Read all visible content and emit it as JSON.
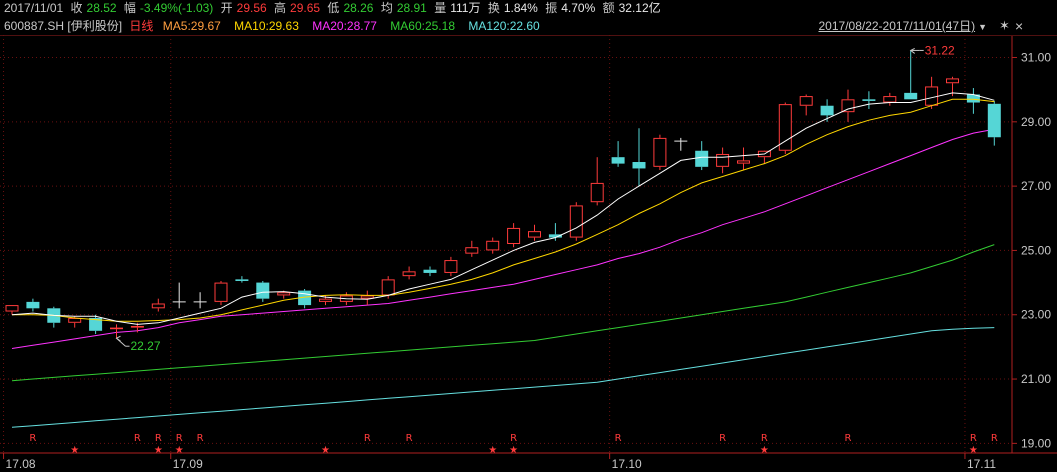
{
  "header": {
    "date": "2017/11/01",
    "close_label": "收",
    "close_value": "28.52",
    "change_label": "幅",
    "change_value": "-3.49%(-1.03)",
    "open_label": "开",
    "open_value": "29.56",
    "high_label": "高",
    "high_value": "29.65",
    "low_label": "低",
    "low_value": "28.26",
    "avg_label": "均",
    "avg_value": "28.91",
    "volume_label": "量",
    "volume_value": "111万",
    "turnover_label": "换",
    "turnover_value": "1.84%",
    "amplitude_label": "振",
    "amplitude_value": "4.70%",
    "amount_label": "额",
    "amount_value": "32.12亿"
  },
  "indicator_bar": {
    "stock": "600887.SH [伊利股份]",
    "period": "日线",
    "ma5": "MA5:29.67",
    "ma10": "MA10:29.63",
    "ma20": "MA20:28.77",
    "ma60": "MA60:25.18",
    "ma120": "MA120:22.60",
    "range": "2017/08/22-2017/11/01(47日)",
    "range_arrow": "▼"
  },
  "icons": {
    "settings": "✶",
    "close": "×"
  },
  "colors": {
    "up": "#ff3b3b",
    "down": "#55d6d6",
    "ma5": "#ffffff",
    "ma10": "#ffd700",
    "ma20": "#ff33ff",
    "ma60": "#33cc33",
    "ma120": "#66e0e0"
  },
  "chart_data": {
    "type": "candlestick",
    "ylim": [
      18.7,
      31.7
    ],
    "y_ticks": [
      "31.00",
      "29.00",
      "27.00",
      "25.00",
      "23.00",
      "21.00",
      "19.00"
    ],
    "y_tick_values": [
      31,
      29,
      27,
      25,
      23,
      21,
      19
    ],
    "x_labels": [
      {
        "label": "17.08",
        "index": 0
      },
      {
        "label": "17.09",
        "index": 8
      },
      {
        "label": "17.10",
        "index": 29
      },
      {
        "label": "17.11",
        "index": 46
      }
    ],
    "candles": [
      {
        "o": 23.1,
        "h": 23.3,
        "l": 23.0,
        "c": 23.3
      },
      {
        "o": 23.4,
        "h": 23.5,
        "l": 23.1,
        "c": 23.2
      },
      {
        "o": 23.2,
        "h": 23.25,
        "l": 22.6,
        "c": 22.75
      },
      {
        "o": 22.75,
        "h": 22.95,
        "l": 22.6,
        "c": 22.9
      },
      {
        "o": 22.9,
        "h": 23.0,
        "l": 22.4,
        "c": 22.5
      },
      {
        "o": 22.55,
        "h": 22.7,
        "l": 22.27,
        "c": 22.6
      },
      {
        "o": 22.6,
        "h": 22.75,
        "l": 22.45,
        "c": 22.65
      },
      {
        "o": 23.2,
        "h": 23.5,
        "l": 23.1,
        "c": 23.35
      },
      {
        "o": 23.4,
        "h": 24.0,
        "l": 23.2,
        "c": 23.4
      },
      {
        "o": 23.4,
        "h": 23.7,
        "l": 23.2,
        "c": 23.4
      },
      {
        "o": 23.4,
        "h": 24.05,
        "l": 23.3,
        "c": 24.0
      },
      {
        "o": 24.1,
        "h": 24.2,
        "l": 24.0,
        "c": 24.05
      },
      {
        "o": 24.0,
        "h": 24.05,
        "l": 23.4,
        "c": 23.5
      },
      {
        "o": 23.6,
        "h": 23.75,
        "l": 23.5,
        "c": 23.7
      },
      {
        "o": 23.75,
        "h": 23.8,
        "l": 23.2,
        "c": 23.3
      },
      {
        "o": 23.4,
        "h": 23.6,
        "l": 23.3,
        "c": 23.5
      },
      {
        "o": 23.4,
        "h": 23.7,
        "l": 23.3,
        "c": 23.6
      },
      {
        "o": 23.5,
        "h": 23.75,
        "l": 23.3,
        "c": 23.6
      },
      {
        "o": 23.6,
        "h": 24.2,
        "l": 23.5,
        "c": 24.1
      },
      {
        "o": 24.2,
        "h": 24.5,
        "l": 24.1,
        "c": 24.35
      },
      {
        "o": 24.4,
        "h": 24.5,
        "l": 24.2,
        "c": 24.3
      },
      {
        "o": 24.3,
        "h": 24.8,
        "l": 24.2,
        "c": 24.7
      },
      {
        "o": 24.9,
        "h": 25.3,
        "l": 24.8,
        "c": 25.1
      },
      {
        "o": 25.0,
        "h": 25.4,
        "l": 24.9,
        "c": 25.3
      },
      {
        "o": 25.2,
        "h": 25.85,
        "l": 25.1,
        "c": 25.7
      },
      {
        "o": 25.4,
        "h": 25.8,
        "l": 25.3,
        "c": 25.6
      },
      {
        "o": 25.5,
        "h": 25.85,
        "l": 25.3,
        "c": 25.4
      },
      {
        "o": 25.4,
        "h": 26.5,
        "l": 25.3,
        "c": 26.4
      },
      {
        "o": 26.5,
        "h": 27.9,
        "l": 26.4,
        "c": 27.1
      },
      {
        "o": 27.9,
        "h": 28.4,
        "l": 27.6,
        "c": 27.7
      },
      {
        "o": 27.75,
        "h": 28.8,
        "l": 27.0,
        "c": 27.55
      },
      {
        "o": 27.6,
        "h": 28.6,
        "l": 27.5,
        "c": 28.5
      },
      {
        "o": 28.4,
        "h": 28.5,
        "l": 28.1,
        "c": 28.4
      },
      {
        "o": 28.1,
        "h": 28.4,
        "l": 27.5,
        "c": 27.6
      },
      {
        "o": 27.6,
        "h": 28.2,
        "l": 27.4,
        "c": 28.0
      },
      {
        "o": 27.7,
        "h": 28.2,
        "l": 27.5,
        "c": 27.8
      },
      {
        "o": 27.9,
        "h": 28.0,
        "l": 27.7,
        "c": 28.1
      },
      {
        "o": 28.1,
        "h": 29.6,
        "l": 28.0,
        "c": 29.55
      },
      {
        "o": 29.5,
        "h": 29.85,
        "l": 29.2,
        "c": 29.8
      },
      {
        "o": 29.5,
        "h": 29.7,
        "l": 29.0,
        "c": 29.2
      },
      {
        "o": 29.3,
        "h": 30.0,
        "l": 29.0,
        "c": 29.7
      },
      {
        "o": 29.7,
        "h": 29.95,
        "l": 29.4,
        "c": 29.65
      },
      {
        "o": 29.6,
        "h": 29.9,
        "l": 29.5,
        "c": 29.8
      },
      {
        "o": 29.9,
        "h": 31.22,
        "l": 29.7,
        "c": 29.7
      },
      {
        "o": 29.5,
        "h": 30.4,
        "l": 29.4,
        "c": 30.1
      },
      {
        "o": 30.2,
        "h": 30.4,
        "l": 29.8,
        "c": 30.35
      },
      {
        "o": 29.85,
        "h": 30.05,
        "l": 29.25,
        "c": 29.6
      },
      {
        "o": 29.56,
        "h": 29.65,
        "l": 28.26,
        "c": 28.52
      }
    ],
    "ma5": [
      23.0,
      23.05,
      22.98,
      22.95,
      22.95,
      22.8,
      22.7,
      22.75,
      22.9,
      23.05,
      23.2,
      23.55,
      23.7,
      23.72,
      23.65,
      23.55,
      23.5,
      23.48,
      23.6,
      23.8,
      23.95,
      24.1,
      24.4,
      24.7,
      25.0,
      25.25,
      25.4,
      25.7,
      26.1,
      26.6,
      27.0,
      27.4,
      27.8,
      27.9,
      27.9,
      27.95,
      28.0,
      28.4,
      28.8,
      29.1,
      29.4,
      29.55,
      29.6,
      29.6,
      29.75,
      29.9,
      29.85,
      29.67
    ],
    "ma10": [
      23.0,
      23.0,
      22.98,
      22.9,
      22.85,
      22.8,
      22.8,
      22.82,
      22.85,
      22.9,
      23.0,
      23.15,
      23.3,
      23.45,
      23.55,
      23.6,
      23.62,
      23.6,
      23.6,
      23.7,
      23.82,
      23.95,
      24.1,
      24.3,
      24.55,
      24.75,
      24.95,
      25.2,
      25.5,
      25.8,
      26.15,
      26.45,
      26.8,
      27.1,
      27.3,
      27.5,
      27.7,
      27.95,
      28.3,
      28.6,
      28.85,
      29.05,
      29.2,
      29.3,
      29.5,
      29.7,
      29.7,
      29.63
    ],
    "ma20": [
      21.95,
      22.05,
      22.15,
      22.25,
      22.35,
      22.45,
      22.5,
      22.6,
      22.75,
      22.85,
      22.95,
      23.0,
      23.05,
      23.1,
      23.15,
      23.2,
      23.25,
      23.3,
      23.35,
      23.45,
      23.55,
      23.65,
      23.75,
      23.85,
      23.95,
      24.1,
      24.25,
      24.4,
      24.55,
      24.75,
      24.9,
      25.1,
      25.35,
      25.55,
      25.8,
      26.0,
      26.2,
      26.45,
      26.7,
      26.95,
      27.2,
      27.45,
      27.7,
      27.95,
      28.2,
      28.45,
      28.65,
      28.77
    ],
    "ma60": [
      20.95,
      21.0,
      21.05,
      21.1,
      21.15,
      21.2,
      21.25,
      21.3,
      21.35,
      21.4,
      21.45,
      21.5,
      21.55,
      21.6,
      21.65,
      21.7,
      21.75,
      21.8,
      21.85,
      21.9,
      21.95,
      22.0,
      22.05,
      22.1,
      22.15,
      22.2,
      22.3,
      22.4,
      22.5,
      22.6,
      22.7,
      22.8,
      22.9,
      23.0,
      23.1,
      23.2,
      23.3,
      23.4,
      23.55,
      23.7,
      23.85,
      24.0,
      24.15,
      24.3,
      24.5,
      24.7,
      24.95,
      25.18
    ],
    "ma120": [
      19.5,
      19.55,
      19.6,
      19.65,
      19.7,
      19.75,
      19.8,
      19.85,
      19.9,
      19.95,
      20.0,
      20.05,
      20.1,
      20.15,
      20.2,
      20.25,
      20.3,
      20.35,
      20.4,
      20.45,
      20.5,
      20.55,
      20.6,
      20.65,
      20.7,
      20.75,
      20.8,
      20.85,
      20.9,
      21.0,
      21.1,
      21.2,
      21.3,
      21.4,
      21.5,
      21.6,
      21.7,
      21.8,
      21.9,
      22.0,
      22.1,
      22.2,
      22.3,
      22.4,
      22.5,
      22.55,
      22.58,
      22.6
    ],
    "annotations": [
      {
        "index": 43,
        "value": 31.22,
        "text": "31.22",
        "color": "#ff3b3b"
      },
      {
        "index": 5,
        "value": 22.27,
        "text": "22.27",
        "color": "#33cc33"
      }
    ],
    "markers": [
      {
        "index": 1,
        "text": "R"
      },
      {
        "index": 3,
        "text": "★"
      },
      {
        "index": 6,
        "text": "R"
      },
      {
        "index": 7,
        "text": "R"
      },
      {
        "index": 7,
        "text": "★"
      },
      {
        "index": 8,
        "text": "R"
      },
      {
        "index": 8,
        "text": "★"
      },
      {
        "index": 9,
        "text": "R"
      },
      {
        "index": 15,
        "text": "★"
      },
      {
        "index": 17,
        "text": "R"
      },
      {
        "index": 19,
        "text": "R"
      },
      {
        "index": 23,
        "text": "★"
      },
      {
        "index": 24,
        "text": "R"
      },
      {
        "index": 24,
        "text": "★"
      },
      {
        "index": 29,
        "text": "R"
      },
      {
        "index": 34,
        "text": "R"
      },
      {
        "index": 36,
        "text": "R"
      },
      {
        "index": 36,
        "text": "★"
      },
      {
        "index": 40,
        "text": "R"
      },
      {
        "index": 46,
        "text": "R"
      },
      {
        "index": 46,
        "text": "★"
      },
      {
        "index": 47,
        "text": "R"
      }
    ]
  }
}
